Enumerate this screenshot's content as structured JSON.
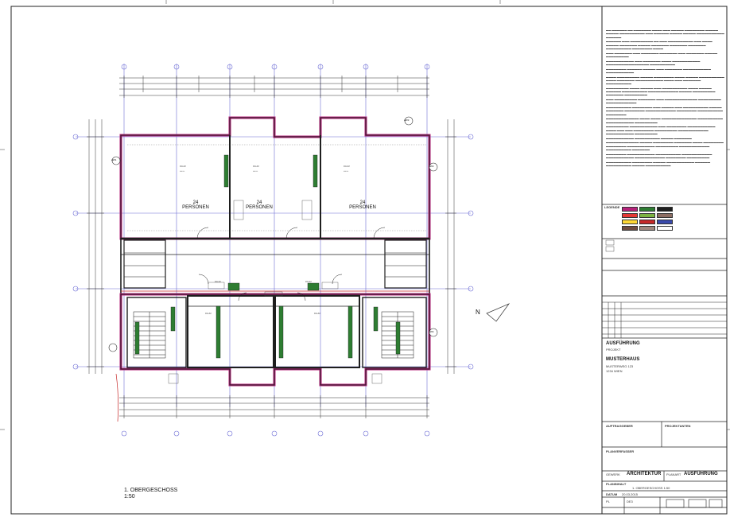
{
  "drawing": {
    "floor_title": "1. OBERGESCHOSS",
    "scale": "1:50",
    "room_text": [
      "24",
      "PERSONEN"
    ],
    "axis_labels_left": [
      "A",
      "B",
      "C",
      "D",
      "E"
    ],
    "north_label": "N",
    "tags": [
      "AW1",
      "AW2",
      "AW3",
      "AW4"
    ]
  },
  "title_block": {
    "legend_label": "LEGENDE",
    "plan_status_label": "AUSFÜHRUNG",
    "project_label": "PROJEKT",
    "project_name": "MUSTERHAUS",
    "address_line1": "MUSTERWEG 123",
    "address_line2": "1234 WIEN",
    "client_label": "AUFTRAGGEBER",
    "designer_label": "PROJEKTANTEN",
    "planner_label": "PLANVERFASSER",
    "discipline_label": "GEWERK",
    "discipline_value": "ARCHITEKTUR",
    "plan_type_label": "PLANART",
    "plan_type_value": "AUSFÜHRUNG",
    "plan_content_label": "PLANINHALT",
    "plan_content_value": "1. OBERGESCHOSS   1:50",
    "date_label": "DATUM",
    "date_value": "20.03.2015",
    "index_label": "PL",
    "index_value": "DE3",
    "revision_label": "PLANINDEX"
  },
  "colors": {
    "wall_magenta": "#b5217a",
    "wall_black": "#1e1e1e",
    "green_core": "#2e7d32",
    "red_line": "#c62828",
    "grid_blue": "#6d6dd6",
    "frame": "#222222"
  }
}
